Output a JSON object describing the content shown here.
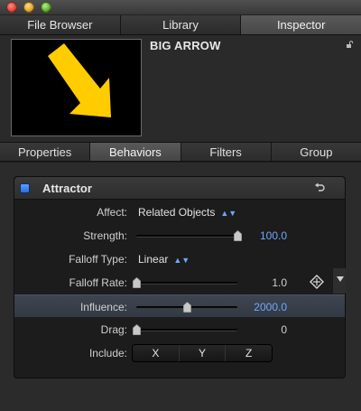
{
  "window": {
    "controls": [
      "close",
      "minimize",
      "zoom"
    ]
  },
  "top_tabs": [
    {
      "label": "File Browser",
      "active": false
    },
    {
      "label": "Library",
      "active": false
    },
    {
      "label": "Inspector",
      "active": true
    }
  ],
  "header": {
    "clip_name": "BIG ARROW",
    "lock_icon": "lock-icon",
    "thumbnail_color": "#ffcc00"
  },
  "sub_tabs": [
    {
      "label": "Properties",
      "active": false
    },
    {
      "label": "Behaviors",
      "active": true
    },
    {
      "label": "Filters",
      "active": false
    },
    {
      "label": "Group",
      "active": false
    }
  ],
  "behavior": {
    "title": "Attractor",
    "enabled": true,
    "reset_icon": "reset-icon",
    "params": {
      "affect": {
        "label": "Affect:",
        "value": "Related Objects"
      },
      "strength": {
        "label": "Strength:",
        "value": "100.0",
        "slider_fraction": 1.0
      },
      "falloff_type": {
        "label": "Falloff Type:",
        "value": "Linear"
      },
      "falloff_rate": {
        "label": "Falloff Rate:",
        "value": "1.0",
        "slider_fraction": 0.0
      },
      "influence": {
        "label": "Influence:",
        "value": "2000.0",
        "slider_fraction": 0.5
      },
      "drag": {
        "label": "Drag:",
        "value": "0",
        "slider_fraction": 0.0
      },
      "include": {
        "label": "Include:",
        "options": [
          "X",
          "Y",
          "Z"
        ]
      }
    }
  },
  "colors": {
    "accent_blue": "#6ea8ff",
    "checkbox_blue": "#2a6fdc",
    "highlight_row": "#3a414b"
  }
}
